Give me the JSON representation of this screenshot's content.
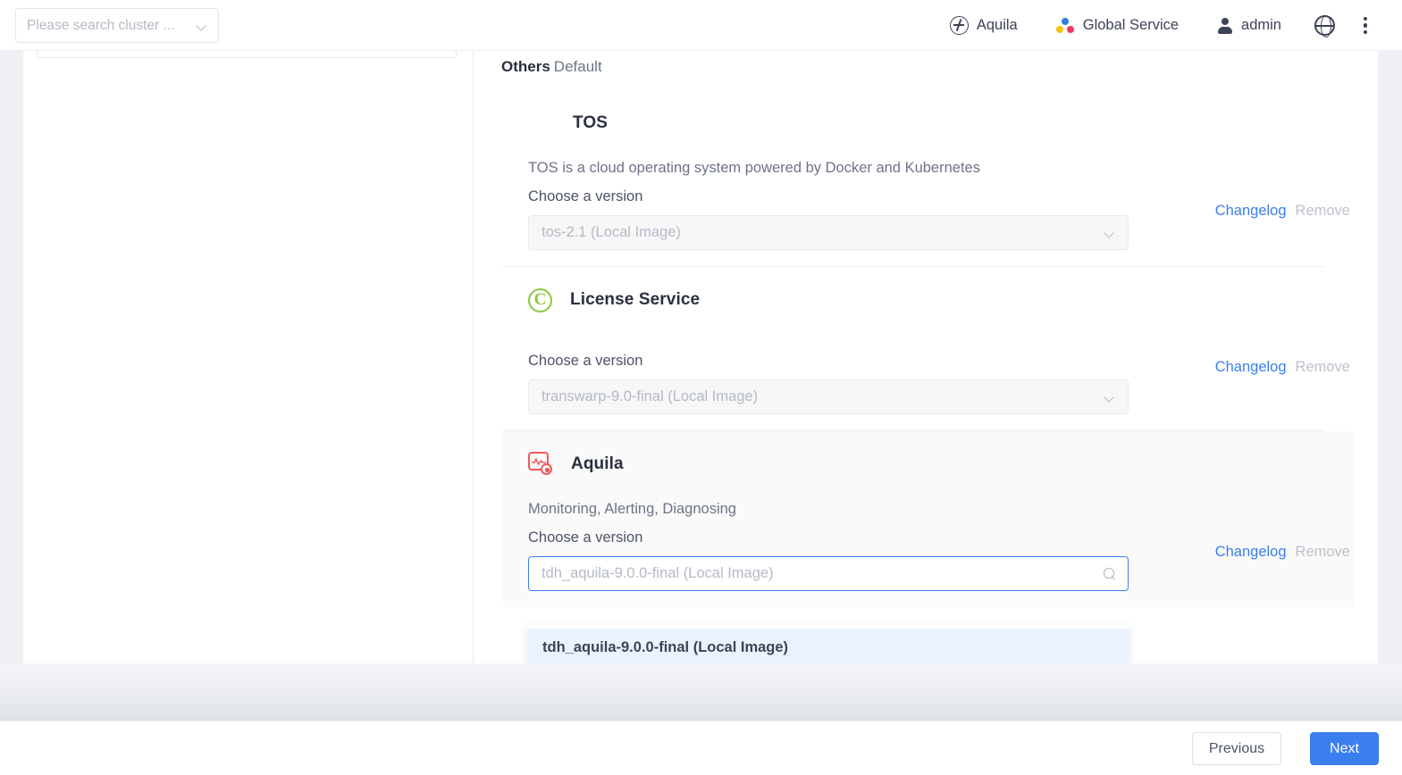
{
  "header": {
    "cluster_search": {
      "placeholder": "Please search cluster ...",
      "icon": "chevron-down-icon"
    },
    "nav": [
      {
        "id": "aquila",
        "label": "Aquila",
        "icon": "aquila-nav-icon"
      },
      {
        "id": "global-service",
        "label": "Global Service",
        "icon": "global-service-icon"
      },
      {
        "id": "admin",
        "label": "admin",
        "icon": "user-icon"
      },
      {
        "id": "language",
        "label": "",
        "icon": "globe-icon"
      },
      {
        "id": "more",
        "label": "",
        "icon": "kebab-menu-icon"
      }
    ]
  },
  "content": {
    "group_title": "Others",
    "group_subtitle": "Default",
    "services": [
      {
        "id": "tos",
        "name": "TOS",
        "icon": "none",
        "description": "TOS is a cloud operating system powered by Docker and Kubernetes",
        "version_label": "Choose a version",
        "version_value": "tos-2.1 (Local Image)",
        "version_state": "disabled",
        "changelog_label": "Changelog",
        "remove_label": "Remove",
        "highlighted": false
      },
      {
        "id": "license-service",
        "name": "License Service",
        "icon": "license-copyright-icon",
        "description": "",
        "version_label": "Choose a version",
        "version_value": "transwarp-9.0-final (Local Image)",
        "version_state": "disabled",
        "changelog_label": "Changelog",
        "remove_label": "Remove",
        "highlighted": false
      },
      {
        "id": "aquila",
        "name": "Aquila",
        "icon": "aquila-monitor-icon",
        "description": "Monitoring, Alerting, Diagnosing",
        "version_label": "Choose a version",
        "version_value": "tdh_aquila-9.0.0-final (Local Image)",
        "version_state": "active-search",
        "search_icon": "search-icon",
        "changelog_label": "Changelog",
        "remove_label": "Remove",
        "highlighted": true
      }
    ],
    "dropdown": {
      "open": true,
      "options": [
        {
          "label": "tdh_aquila-9.0.0-final (Local Image)",
          "selected": true
        }
      ]
    }
  },
  "footer": {
    "previous_label": "Previous",
    "next_label": "Next"
  },
  "colors": {
    "accent_blue": "#3b7ef0",
    "license_green": "#8cc63e",
    "aquila_red": "#f05b5b",
    "dropdown_highlight": "#eaf3fd",
    "muted_text": "#b4b9c4"
  }
}
